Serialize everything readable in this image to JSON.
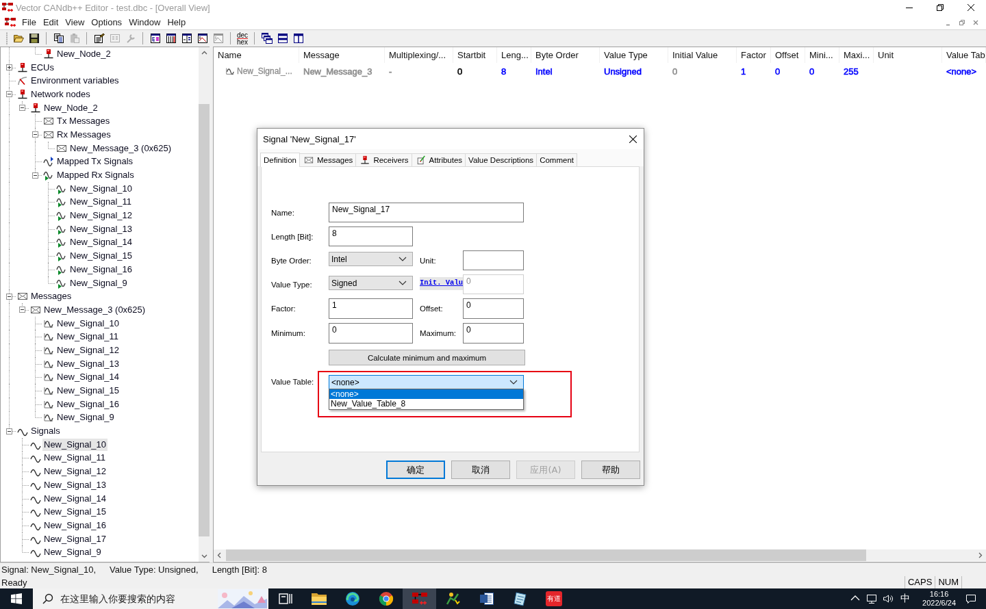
{
  "window": {
    "title": "Vector CANdb++ Editor - test.dbc - [Overall View]"
  },
  "menu": [
    "File",
    "Edit",
    "View",
    "Options",
    "Window",
    "Help"
  ],
  "toolbar": [
    [
      {
        "kind": "open",
        "disabled": false
      },
      {
        "kind": "save",
        "disabled": false
      }
    ],
    [
      {
        "kind": "copy",
        "disabled": false
      },
      {
        "kind": "paste",
        "disabled": true
      }
    ],
    [
      {
        "kind": "edit",
        "disabled": false
      },
      {
        "kind": "form",
        "disabled": true
      },
      {
        "kind": "tool",
        "disabled": true
      }
    ],
    [
      {
        "kind": "tree",
        "disabled": false
      },
      {
        "kind": "table",
        "disabled": false
      },
      {
        "kind": "columns",
        "disabled": false
      },
      {
        "kind": "chart",
        "disabled": false
      },
      {
        "kind": "chart",
        "disabled": true
      }
    ],
    [
      {
        "kind": "dechex",
        "lines": [
          "dec",
          "hex"
        ],
        "disabled": false
      }
    ],
    [
      {
        "kind": "cascade",
        "disabled": false
      },
      {
        "kind": "tileh",
        "disabled": false
      },
      {
        "kind": "tilev",
        "disabled": false
      }
    ]
  ],
  "tree": {
    "items": [
      {
        "children": [
          {
            "children": [
              {
                "label": "New_Node_2",
                "kind": "node",
                "selected": false
              }
            ]
          }
        ]
      },
      {
        "label": "ECUs",
        "kind": "node",
        "expanded": false,
        "selected": false
      },
      {
        "label": "Environment variables",
        "kind": "envvar",
        "selected": false
      },
      {
        "label": "Network nodes",
        "kind": "node",
        "expanded": true,
        "selected": false,
        "children": [
          {
            "label": "New_Node_2",
            "kind": "node",
            "expanded": true,
            "selected": false,
            "children": [
              {
                "label": "Tx Messages",
                "kind": "message",
                "selected": false
              },
              {
                "label": "Rx Messages",
                "kind": "message",
                "expanded": true,
                "selected": false,
                "children": [
                  {
                    "label": "New_Message_3 (0x625)",
                    "kind": "message",
                    "selected": false
                  }
                ]
              },
              {
                "label": "Mapped Tx Signals",
                "kind": "txsignals",
                "selected": false
              },
              {
                "label": "Mapped Rx Signals",
                "kind": "rxsignal",
                "expanded": true,
                "selected": false,
                "children": [
                  {
                    "label": "New_Signal_10",
                    "kind": "rxsignal",
                    "selected": false
                  },
                  {
                    "label": "New_Signal_11",
                    "kind": "rxsignal",
                    "selected": false
                  },
                  {
                    "label": "New_Signal_12",
                    "kind": "rxsignal",
                    "selected": false
                  },
                  {
                    "label": "New_Signal_13",
                    "kind": "rxsignal",
                    "selected": false
                  },
                  {
                    "label": "New_Signal_14",
                    "kind": "rxsignal",
                    "selected": false
                  },
                  {
                    "label": "New_Signal_15",
                    "kind": "rxsignal",
                    "selected": false
                  },
                  {
                    "label": "New_Signal_16",
                    "kind": "rxsignal",
                    "selected": false
                  },
                  {
                    "label": "New_Signal_9",
                    "kind": "rxsignal",
                    "selected": false
                  }
                ]
              }
            ]
          }
        ]
      },
      {
        "label": "Messages",
        "kind": "message",
        "expanded": true,
        "selected": false,
        "children": [
          {
            "label": "New_Message_3 (0x625)",
            "kind": "message",
            "expanded": true,
            "selected": false,
            "children": [
              {
                "label": "New_Signal_10",
                "kind": "msgsignal",
                "selected": false
              },
              {
                "label": "New_Signal_11",
                "kind": "msgsignal",
                "selected": false
              },
              {
                "label": "New_Signal_12",
                "kind": "msgsignal",
                "selected": false
              },
              {
                "label": "New_Signal_13",
                "kind": "msgsignal",
                "selected": false
              },
              {
                "label": "New_Signal_14",
                "kind": "msgsignal",
                "selected": false
              },
              {
                "label": "New_Signal_15",
                "kind": "msgsignal",
                "selected": false
              },
              {
                "label": "New_Signal_16",
                "kind": "msgsignal",
                "selected": false
              },
              {
                "label": "New_Signal_9",
                "kind": "msgsignal",
                "selected": false
              }
            ]
          }
        ]
      },
      {
        "label": "Signals",
        "kind": "signal",
        "expanded": true,
        "selected": false,
        "children": [
          {
            "label": "New_Signal_10",
            "kind": "signal",
            "selected": true
          },
          {
            "label": "New_Signal_11",
            "kind": "signal",
            "selected": false
          },
          {
            "label": "New_Signal_12",
            "kind": "signal",
            "selected": false
          },
          {
            "label": "New_Signal_13",
            "kind": "signal",
            "selected": false
          },
          {
            "label": "New_Signal_14",
            "kind": "signal",
            "selected": false
          },
          {
            "label": "New_Signal_15",
            "kind": "signal",
            "selected": false
          },
          {
            "label": "New_Signal_16",
            "kind": "signal",
            "selected": false
          },
          {
            "label": "New_Signal_17",
            "kind": "signal",
            "selected": false
          },
          {
            "label": "New_Signal_9",
            "kind": "signal",
            "selected": false
          }
        ]
      }
    ]
  },
  "table": {
    "columns": [
      {
        "label": "Name"
      },
      {
        "label": "Message"
      },
      {
        "label": "Multiplexing/..."
      },
      {
        "label": "Startbit"
      },
      {
        "label": "Leng..."
      },
      {
        "label": "Byte Order"
      },
      {
        "label": "Value Type"
      },
      {
        "label": "Initial Value"
      },
      {
        "label": "Factor"
      },
      {
        "label": "Offset"
      },
      {
        "label": "Mini..."
      },
      {
        "label": "Maxi..."
      },
      {
        "label": "Unit"
      },
      {
        "label": "Value Tab"
      }
    ],
    "rows": [
      {
        "cells": [
          {
            "text": "New_Signal_...",
            "color": "#8c8c8c",
            "kind": "msgsignal"
          },
          {
            "text": "New_Message_3",
            "color": "#8c8c8c"
          },
          {
            "text": "-",
            "color": "#8c8c8c"
          },
          {
            "text": "0",
            "color": "#000000"
          },
          {
            "text": "8",
            "color": "#0000ff"
          },
          {
            "text": "Intel",
            "color": "#0000ff"
          },
          {
            "text": "Unsigned",
            "color": "#0000ff"
          },
          {
            "text": "0",
            "color": "#8c8c8c"
          },
          {
            "text": "1",
            "color": "#0000ff"
          },
          {
            "text": "0",
            "color": "#0000ff"
          },
          {
            "text": "0",
            "color": "#0000ff"
          },
          {
            "text": "255",
            "color": "#0000ff"
          },
          null,
          {
            "text": "<none>",
            "color": "#0000ff"
          }
        ]
      }
    ]
  },
  "dialog": {
    "title": "Signal 'New_Signal_17'",
    "tabs": [
      {
        "label": "Definition",
        "kind": "plain",
        "selected": true
      },
      {
        "label": "Messages",
        "kind": "message",
        "selected": false
      },
      {
        "label": "Receivers",
        "kind": "node",
        "selected": false
      },
      {
        "label": "Attributes",
        "kind": "attribute",
        "selected": false
      },
      {
        "label": "Value Descriptions",
        "kind": "plain",
        "selected": false
      },
      {
        "label": "Comment",
        "kind": "plain",
        "selected": false
      }
    ],
    "form": {
      "name": {
        "label": "Name:",
        "value": "New_Signal_17"
      },
      "length": {
        "label": "Length [Bit]:",
        "value": "8"
      },
      "byte_order": {
        "label": "Byte Order:",
        "value": "Intel"
      },
      "unit": {
        "label": "Unit:"
      },
      "value_type": {
        "label": "Value Type:",
        "value": "Signed"
      },
      "init_value": {
        "label": "Init. Valu",
        "value": "0",
        "disabled": true
      },
      "factor": {
        "label": "Factor:",
        "value": "1"
      },
      "offset": {
        "label": "Offset:",
        "value": "0"
      },
      "minimum": {
        "label": "Minimum:",
        "value": "0"
      },
      "maximum": {
        "label": "Maximum:",
        "value": "0"
      },
      "calculate_button": "Calculate minimum and maximum",
      "value_table": {
        "label": "Value Table:",
        "value": "<none>",
        "expanded": true,
        "highlighted": true,
        "options": [
          {
            "label": "<none>",
            "selected": true
          },
          {
            "label": "New_Value_Table_8",
            "selected": false
          }
        ]
      }
    },
    "buttons": [
      {
        "label": "确定",
        "default": true,
        "disabled": false
      },
      {
        "label": "取消",
        "default": false,
        "disabled": false
      },
      {
        "label": "应用(A)",
        "default": false,
        "disabled": true
      },
      {
        "label": "帮助",
        "default": false,
        "disabled": false
      }
    ]
  },
  "status_bar": {
    "fields": [
      "Signal: New_Signal_10,",
      "Value Type: Unsigned,",
      "Length [Bit]: 8"
    ],
    "message": "Ready",
    "indicators": [
      "CAPS",
      "NUM"
    ]
  },
  "taskbar": {
    "search": {
      "placeholder": "在这里输入你要搜索的内容"
    },
    "apps": [
      {
        "kind": "taskview",
        "active": false
      },
      {
        "kind": "folder",
        "active": false
      },
      {
        "kind": "swirl",
        "active": false
      },
      {
        "kind": "browser",
        "active": false
      },
      {
        "kind": "diagram",
        "active": true
      },
      {
        "kind": "figure",
        "active": false
      },
      {
        "kind": "document",
        "active": false
      },
      {
        "kind": "notepad",
        "active": false
      },
      {
        "kind": "tile",
        "label": "有道",
        "active": false
      }
    ],
    "tray": {
      "ime": "中",
      "time": "16:16",
      "date": "2022/6/24"
    }
  }
}
